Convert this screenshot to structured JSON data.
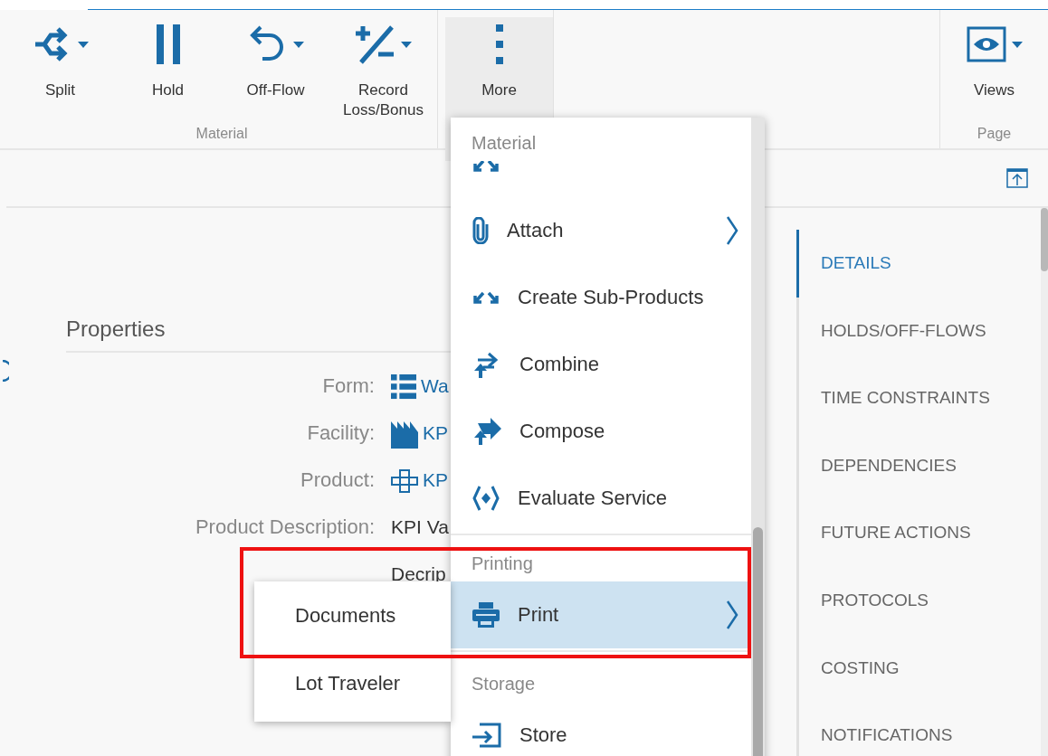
{
  "ribbon": {
    "groups": [
      {
        "label": "Material",
        "buttons": [
          {
            "label": "Split",
            "has_dropdown": true,
            "pressed": false
          },
          {
            "label": "Hold",
            "has_dropdown": false,
            "pressed": false
          },
          {
            "label": "Off-Flow",
            "has_dropdown": true,
            "pressed": false
          },
          {
            "label": "Record Loss/Bonus",
            "has_dropdown": true,
            "pressed": false
          }
        ]
      },
      {
        "buttons": [
          {
            "label": "More",
            "has_dropdown": false,
            "pressed": true
          }
        ]
      },
      {
        "label": "Page",
        "buttons": [
          {
            "label": "Views",
            "has_dropdown": true,
            "pressed": false
          }
        ]
      }
    ]
  },
  "properties": {
    "title": "Properties",
    "fields": [
      {
        "label": "Form:",
        "value": "Wa",
        "kind": "link"
      },
      {
        "label": "Facility:",
        "value": "KP",
        "kind": "link"
      },
      {
        "label": "Product:",
        "value": "KP",
        "kind": "link"
      },
      {
        "label": "Product Description:",
        "value": "KPI Va",
        "kind": "text"
      },
      {
        "value": "Decrip",
        "kind": "text"
      }
    ]
  },
  "more_menu": {
    "sections": [
      {
        "title": "Material",
        "items": [
          {
            "label": "Attach",
            "has_submenu": true,
            "selected": false
          },
          {
            "label": "Create Sub-Products",
            "has_submenu": false,
            "selected": false
          },
          {
            "label": "Combine",
            "has_submenu": false,
            "selected": false
          },
          {
            "label": "Compose",
            "has_submenu": false,
            "selected": false
          },
          {
            "label": "Evaluate Service",
            "has_submenu": false,
            "selected": false
          }
        ]
      },
      {
        "title": "Printing",
        "items": [
          {
            "label": "Print",
            "has_submenu": true,
            "selected": true
          }
        ]
      },
      {
        "title": "Storage",
        "items": [
          {
            "label": "Store",
            "has_submenu": false,
            "selected": false
          }
        ]
      }
    ]
  },
  "print_submenu": {
    "items": [
      {
        "label": "Documents",
        "selected": false
      },
      {
        "label": "Lot Traveler",
        "selected": false
      }
    ]
  },
  "side_nav": {
    "items": [
      {
        "label": "DETAILS",
        "selected": true
      },
      {
        "label": "HOLDS/OFF-FLOWS",
        "selected": false
      },
      {
        "label": "TIME CONSTRAINTS",
        "selected": false
      },
      {
        "label": "DEPENDENCIES",
        "selected": false
      },
      {
        "label": "FUTURE ACTIONS",
        "selected": false
      },
      {
        "label": "PROTOCOLS",
        "selected": false
      },
      {
        "label": "COSTING",
        "selected": false
      },
      {
        "label": "NOTIFICATIONS",
        "selected": false
      }
    ]
  }
}
